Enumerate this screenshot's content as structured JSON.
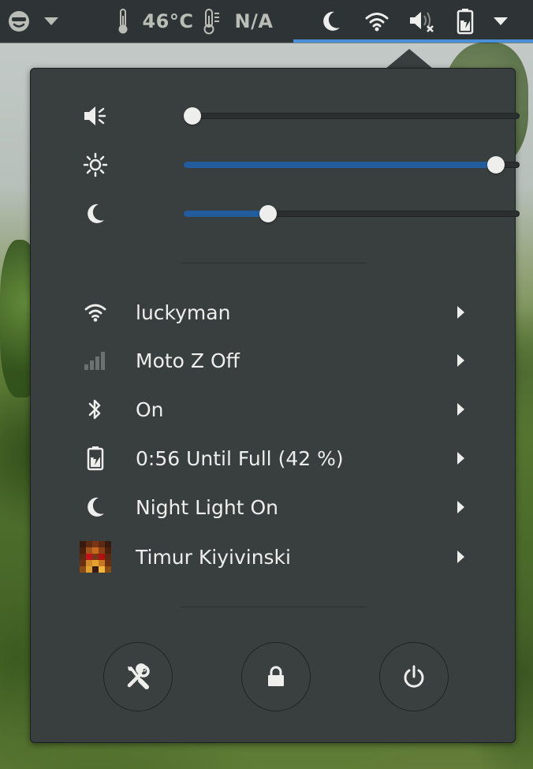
{
  "topbar": {
    "temperature": "46°C",
    "second_sensor": "N/A",
    "icons": [
      "caja-face-icon",
      "dropdown-arrow-icon",
      "thermometer-icon",
      "thermometer-alt-icon",
      "night-light-icon",
      "wifi-icon",
      "volume-muted-icon",
      "battery-charging-icon",
      "menu-arrow-icon"
    ]
  },
  "sliders": {
    "volume": {
      "level_percent": 0,
      "icon": "volume-low-icon"
    },
    "brightness": {
      "level_percent": 93,
      "icon": "brightness-icon"
    },
    "night_light": {
      "level_percent": 25,
      "icon": "night-light-icon"
    }
  },
  "menu": {
    "items": [
      {
        "label": "luckyman",
        "icon": "wifi-icon"
      },
      {
        "label": "Moto Z Off",
        "icon": "cellular-signal-icon"
      },
      {
        "label": "On",
        "icon": "bluetooth-icon"
      },
      {
        "label": "0:56 Until Full (42 %)",
        "icon": "battery-charging-icon"
      },
      {
        "label": "Night Light On",
        "icon": "night-light-icon"
      },
      {
        "label": "Timur Kiyivinski",
        "icon": "user-avatar"
      }
    ]
  },
  "actions": [
    {
      "name": "settings",
      "icon": "settings-tools-icon"
    },
    {
      "name": "lock",
      "icon": "lock-icon"
    },
    {
      "name": "power",
      "icon": "power-icon"
    }
  ],
  "colors": {
    "panel": "#393f3f",
    "topbar": "#2e3436",
    "accent": "#215d9c",
    "active_indicator": "#4a90d9",
    "text": "#eeeeec"
  }
}
